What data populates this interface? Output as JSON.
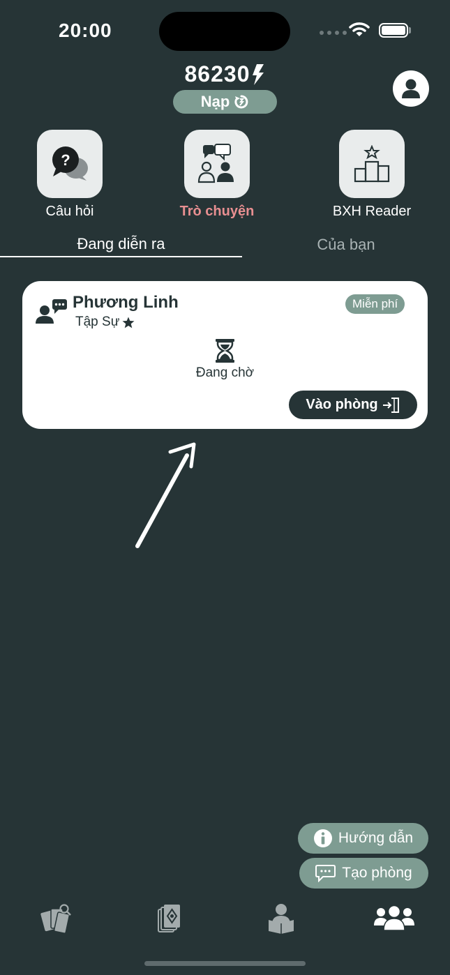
{
  "status_bar": {
    "time": "20:00"
  },
  "header": {
    "balance": "86230",
    "topup_label": "Nạp"
  },
  "categories": [
    {
      "label": "Câu hỏi",
      "icon": "question-chat-icon",
      "active": false
    },
    {
      "label": "Trò chuyện",
      "icon": "chat-people-icon",
      "active": true
    },
    {
      "label": "BXH Reader",
      "icon": "podium-icon",
      "active": false
    }
  ],
  "tabs": [
    {
      "label": "Đang diễn ra",
      "active": true
    },
    {
      "label": "Của bạn",
      "active": false
    }
  ],
  "room": {
    "host_name": "Phương Linh",
    "host_rank": "Tập Sự",
    "price_badge": "Miễn phí",
    "status": "Đang chờ",
    "enter_label": "Vào phòng"
  },
  "actions": {
    "guide_label": "Hướng dẫn",
    "create_room_label": "Tạo phòng"
  },
  "bottom_nav": [
    {
      "icon": "tarot-cards-icon",
      "active": false
    },
    {
      "icon": "card-deck-icon",
      "active": false
    },
    {
      "icon": "reader-icon",
      "active": false
    },
    {
      "icon": "community-icon",
      "active": true
    }
  ],
  "colors": {
    "background": "#263436",
    "accent_green": "#7e9c92",
    "active_tab_pink": "#e88f91",
    "card": "#ffffff"
  }
}
